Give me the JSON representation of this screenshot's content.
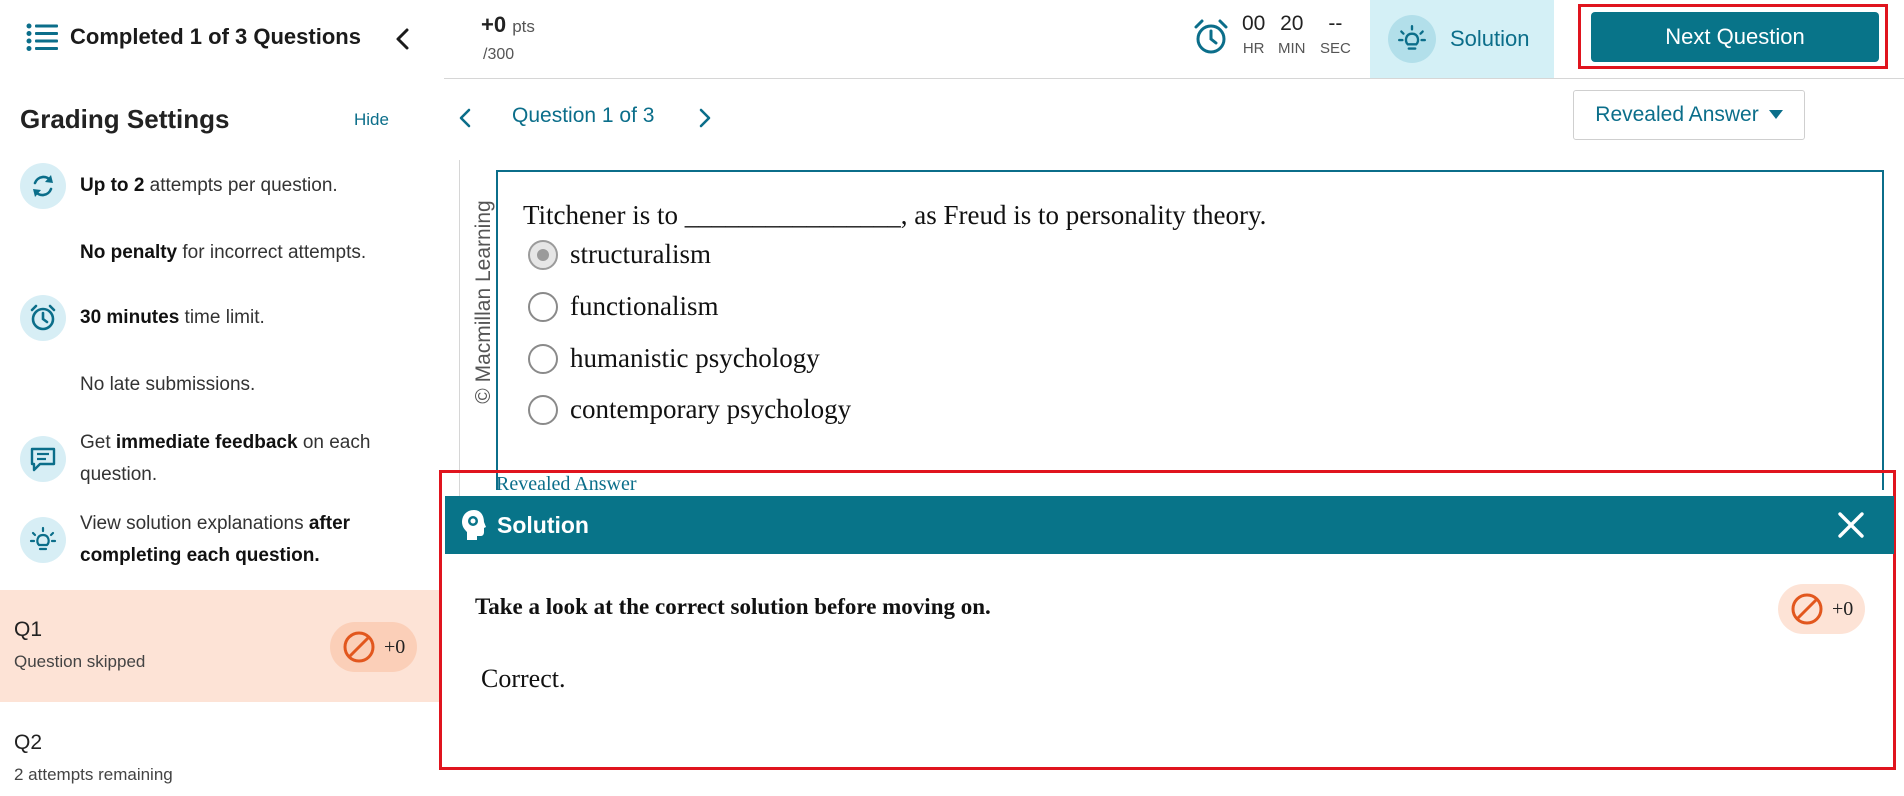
{
  "sidebar": {
    "progress_title": "Completed 1 of 3 Questions",
    "grading_title": "Grading Settings",
    "hide_label": "Hide",
    "rules": [
      {
        "icon": "refresh-icon",
        "bold": "Up to 2",
        "rest": " attempts per question."
      },
      {
        "icon": "",
        "bold": "No penalty",
        "rest": " for incorrect attempts."
      },
      {
        "icon": "alarm-clock-icon",
        "bold": "30 minutes",
        "rest": " time limit."
      },
      {
        "icon": "",
        "bold": "",
        "rest": "No late submissions."
      },
      {
        "icon": "feedback-icon",
        "pre": "Get ",
        "bold": "immediate feedback",
        "rest": " on each question."
      },
      {
        "icon": "lightbulb-icon",
        "pre": "View solution explanations ",
        "bold": "after completing each question.",
        "rest": ""
      }
    ],
    "questions": [
      {
        "name": "Q1",
        "status": "Question skipped",
        "score": "+0",
        "active": true
      },
      {
        "name": "Q2",
        "status": "2 attempts remaining",
        "active": false
      }
    ]
  },
  "topbar": {
    "points": "+0",
    "points_unit": "pts",
    "points_total": "/300",
    "timer": {
      "hr": "00",
      "min": "20",
      "sec": "--",
      "hr_label": "HR",
      "min_label": "MIN",
      "sec_label": "SEC"
    },
    "solution_label": "Solution",
    "next_label": "Next Question"
  },
  "question_nav": {
    "label": "Question 1 of 3",
    "revealed_dropdown": "Revealed Answer"
  },
  "question": {
    "watermark": "© Macmillan Learning",
    "text": "Titchener is to ________________, as Freud is to personality theory.",
    "choices": [
      {
        "label": "structuralism",
        "selected": true
      },
      {
        "label": "functionalism",
        "selected": false
      },
      {
        "label": "humanistic psychology",
        "selected": false
      },
      {
        "label": "contemporary psychology",
        "selected": false
      }
    ],
    "revealed_link": "Revealed Answer"
  },
  "solution_panel": {
    "title": "Solution",
    "message": "Take a look at the correct solution before moving on.",
    "score": "+0",
    "body": "Correct."
  },
  "colors": {
    "accent": "#087489",
    "highlight": "#e0141e",
    "active_row": "#fde3d6",
    "skip_icon": "#e2571e"
  }
}
